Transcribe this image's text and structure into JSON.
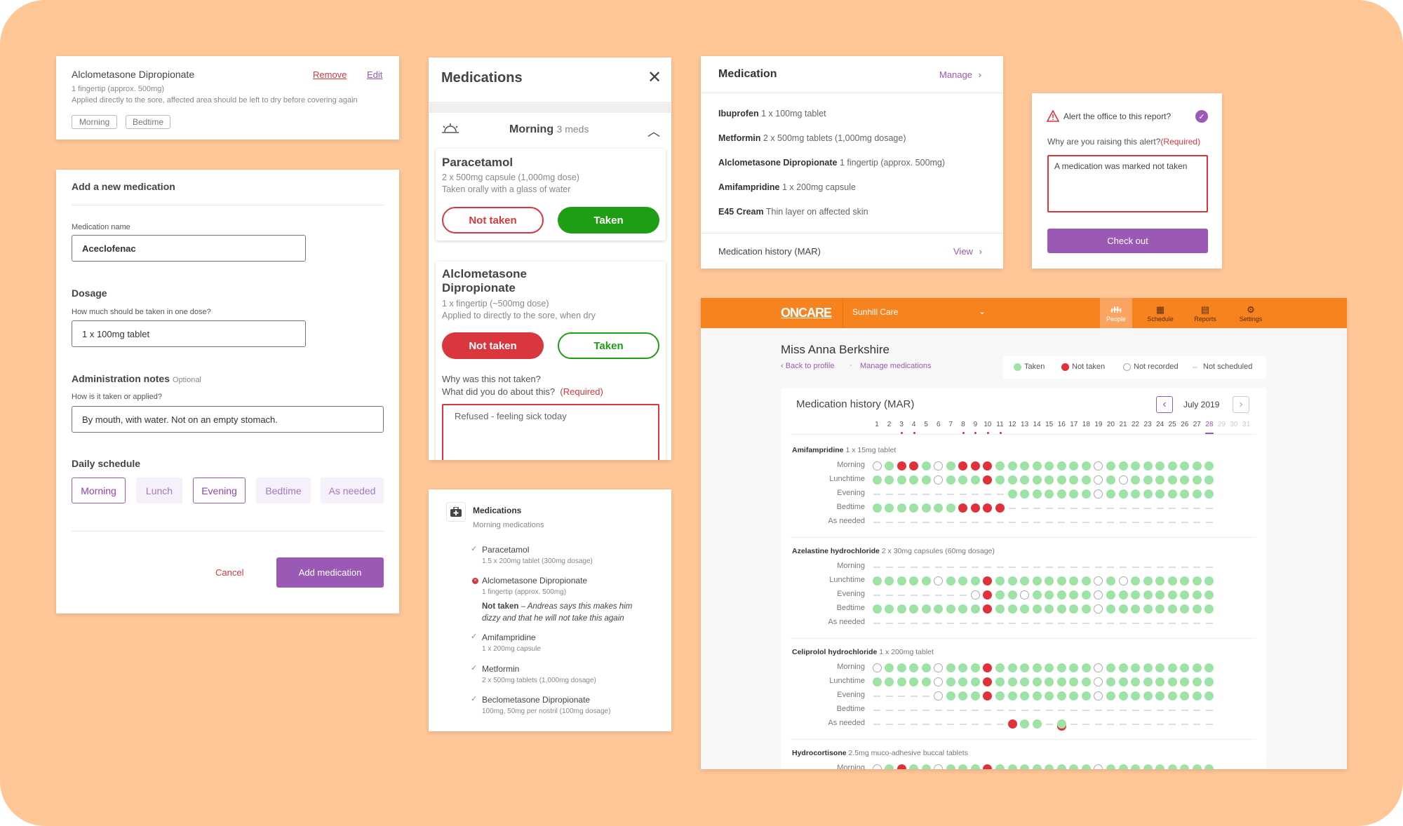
{
  "colors": {
    "background": "#FFC697",
    "brand": "#F7831E",
    "accent": "#9B59B6",
    "taken": "#9EE3A6",
    "not_taken": "#E0313A",
    "taken_button": "#1E9E14"
  },
  "med_card": {
    "name": "Alclometasone Dipropionate",
    "remove": "Remove",
    "edit": "Edit",
    "dose": "1 fingertip (approx. 500mg)",
    "notes": "Applied directly to the sore, affected area should be left to dry before covering again",
    "tags": [
      "Morning",
      "Bedtime"
    ]
  },
  "add_form": {
    "title": "Add a new medication",
    "name_label": "Medication name",
    "name_value": "Aceclofenac",
    "dosage_heading": "Dosage",
    "dosage_label": "How much should be taken in one dose?",
    "dosage_value": "1 x 100mg tablet",
    "notes_heading": "Administration notes",
    "notes_optional": "Optional",
    "notes_label": "How is it taken or applied?",
    "notes_value": "By mouth, with water. Not on an empty stomach.",
    "schedule_heading": "Daily schedule",
    "schedule": [
      {
        "label": "Morning",
        "selected": true
      },
      {
        "label": "Lunch",
        "selected": false
      },
      {
        "label": "Evening",
        "selected": true
      },
      {
        "label": "Bedtime",
        "selected": false
      },
      {
        "label": "As needed",
        "selected": false
      }
    ],
    "cancel": "Cancel",
    "submit": "Add medication"
  },
  "modal": {
    "title": "Medications",
    "group": "Morning",
    "group_count": "3 meds",
    "meds": [
      {
        "name": "Paracetamol",
        "dose": "2 x 500mg capsule (1,000mg dose)",
        "notes": "Taken orally with a glass of water",
        "not_taken": "Not taken",
        "taken": "Taken",
        "state": "taken"
      },
      {
        "name": "Alclometasone Dipropionate",
        "dose": "1 x fingertip (~500mg dose)",
        "notes": "Applied to directly to the sore, when dry",
        "not_taken": "Not taken",
        "taken": "Taken",
        "state": "not_taken"
      }
    ],
    "question1": "Why was this not taken?",
    "question2": "What did you do about this?",
    "required": "(Required)",
    "reason": "Refused - feeling sick today"
  },
  "summary": {
    "title": "Medications",
    "subtitle": "Morning medications",
    "items": [
      {
        "name": "Paracetamol",
        "dose": "1.5 x 200mg tablet (300mg dosage)",
        "status": "taken"
      },
      {
        "name": "Alclometasone Dipropionate",
        "dose": "1 fingertip (approx. 500mg)",
        "status": "not_taken",
        "note_label": "Not taken",
        "note": " – Andreas says this makes him dizzy and that he will not take this again"
      },
      {
        "name": "Amifampridine",
        "dose": "1 x 200mg capsule",
        "status": "taken"
      },
      {
        "name": "Metformin",
        "dose": "2 x 500mg tablets (1,000mg dosage)",
        "status": "taken"
      },
      {
        "name": "Beclometasone Dipropionate",
        "dose": "100mg, 50mg per nostril (100mg dosage)",
        "status": "taken"
      }
    ]
  },
  "medication_panel": {
    "title": "Medication",
    "manage": "Manage",
    "items": [
      {
        "name": "Ibuprofen",
        "dose": "1 x 100mg tablet"
      },
      {
        "name": "Metformin",
        "dose": "2 x 500mg tablets (1,000mg dosage)"
      },
      {
        "name": "Alclometasone Dipropionate",
        "dose": "1 fingertip (approx. 500mg)"
      },
      {
        "name": "Amifampridine",
        "dose": "1 x 200mg capsule"
      },
      {
        "name": "E45 Cream",
        "dose": "Thin layer on affected skin"
      }
    ],
    "history": "Medication history (MAR)",
    "view": "View"
  },
  "alert": {
    "question": "Alert the office to this report?",
    "checked": true,
    "why": "Why are you raising this alert?",
    "required": "(Required)",
    "value": "A medication was marked not taken",
    "button": "Check out"
  },
  "mar": {
    "logo": "ONCARE",
    "org": "Sunhill Care",
    "nav": [
      "People",
      "Schedule",
      "Reports",
      "Settings"
    ],
    "active_nav": "People",
    "patient": "Miss Anna Berkshire",
    "back": "Back to profile",
    "manage": "Manage medications",
    "legend": [
      "Taken",
      "Not taken",
      "Not recorded",
      "Not scheduled"
    ],
    "title": "Medication history (MAR)",
    "month": "July 2019",
    "today": 28,
    "days_in_month": 31,
    "alert_days": [
      3,
      4,
      8,
      9,
      10,
      11
    ],
    "state_key": {
      "T": "taken",
      "N": "not taken",
      "R": "not recorded",
      "-": "not scheduled",
      "M": "taken and not taken"
    },
    "sections": [
      {
        "name": "Amifampridine",
        "dose": "1 x 15mg tablet",
        "rows": [
          {
            "label": "Morning",
            "states": "RTNNTRTNNNTTTTTTTTRTTTTTTTTT"
          },
          {
            "label": "Lunchtime",
            "states": "TTTTTRTTTNTTTTTTTTRTRTTTTTTT"
          },
          {
            "label": "Evening",
            "states": "-----------TTTTTTTRTTTTTTTTT"
          },
          {
            "label": "Bedtime",
            "states": "TTTTTTTNNNN-----------------"
          },
          {
            "label": "As needed",
            "states": "----------------------------"
          }
        ]
      },
      {
        "name": "Azelastine hydrochloride",
        "dose": "2 x 30mg capsules (60mg dosage)",
        "rows": [
          {
            "label": "Morning",
            "states": "----------------------------"
          },
          {
            "label": "Lunchtime",
            "states": "TTTTTRTTTNTTTTTTTTRTRTTTTTTT"
          },
          {
            "label": "Evening",
            "states": "--------RNTTRTTTTTRTTTTTTTTT"
          },
          {
            "label": "Bedtime",
            "states": "TTTTTTTTTNTTTTTTTTRTTTTTTTTT"
          },
          {
            "label": "As needed",
            "states": "----------------------------"
          }
        ]
      },
      {
        "name": "Celiprolol hydrochloride",
        "dose": "1 x 200mg tablet",
        "rows": [
          {
            "label": "Morning",
            "states": "RTTTTRTTTNTTTTTTTTRTTTTTTTTT"
          },
          {
            "label": "Lunchtime",
            "states": "TTTTTRTTTNTTTTTTTTRTTTTTTTTT"
          },
          {
            "label": "Evening",
            "states": "-----RTTTNTTTTTTTTRTTTTTTTTT"
          },
          {
            "label": "Bedtime",
            "states": "----------------------------"
          },
          {
            "label": "As needed",
            "states": "-----------NTT-M------------"
          }
        ]
      },
      {
        "name": "Hydrocortisone",
        "dose": "2.5mg muco-adhesive buccal tablets",
        "rows": [
          {
            "label": "Morning",
            "states": "RTNTTRTTTNTTTTTTTTRTTTTTTTTT"
          }
        ]
      }
    ]
  }
}
